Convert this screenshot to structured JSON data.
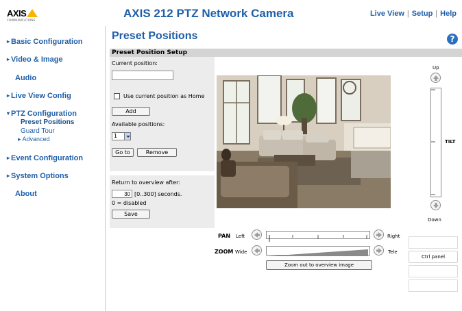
{
  "header": {
    "logo_text": "AXIS",
    "logo_sub": "COMMUNICATIONS",
    "title": "AXIS 212 PTZ Network Camera",
    "nav": {
      "live_view": "Live View",
      "setup": "Setup",
      "help": "Help",
      "separator": "|"
    }
  },
  "sidebar": {
    "items": [
      {
        "label": "Basic Configuration",
        "arrow": "▸"
      },
      {
        "label": "Video & Image",
        "arrow": "▸"
      },
      {
        "label": "Audio",
        "arrow": ""
      },
      {
        "label": "Live View Config",
        "arrow": "▸"
      },
      {
        "label": "PTZ Configuration",
        "arrow": "▾"
      },
      {
        "label": "Event Configuration",
        "arrow": "▸"
      },
      {
        "label": "System Options",
        "arrow": "▸"
      },
      {
        "label": "About",
        "arrow": ""
      }
    ],
    "ptz_sub": {
      "preset_positions": "Preset Positions",
      "guard_tour": "Guard Tour",
      "advanced": "Advanced",
      "advanced_arrow": "▸"
    }
  },
  "main": {
    "page_title": "Preset Positions",
    "help_icon": "?",
    "section_title": "Preset Position Setup",
    "current_position_label": "Current position:",
    "current_position_value": "",
    "use_home_label": "Use current position as Home",
    "add_label": "Add",
    "available_label": "Available positions:",
    "available_selected": "1",
    "goto_label": "Go to",
    "remove_label": "Remove",
    "return_label": "Return to overview after:",
    "return_value": "30",
    "return_range": "[0..300] seconds.",
    "return_note": "0 = disabled",
    "save_label": "Save"
  },
  "ptz": {
    "tilt_up": "Up",
    "tilt_down": "Down",
    "tilt_label": "TILT",
    "pan_label": "PAN",
    "pan_left": "Left",
    "pan_right": "Right",
    "zoom_label": "ZOOM",
    "zoom_wide": "Wide",
    "zoom_tele": "Tele",
    "zoom_out_button": "Zoom out to overview image",
    "ctrl_panel": "Ctrl panel"
  },
  "colors": {
    "link_blue": "#1f5fa8",
    "logo_yellow": "#f7b500",
    "panel_gray": "#ececec"
  }
}
